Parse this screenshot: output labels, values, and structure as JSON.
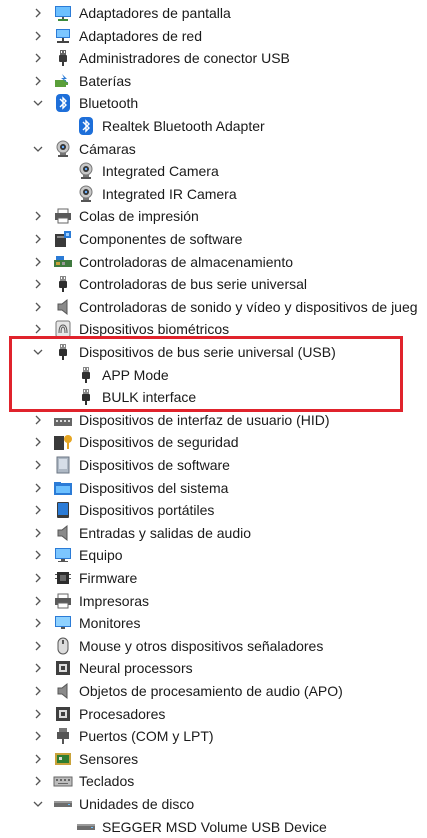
{
  "device_tree": [
    {
      "label": "Adaptadores de pantalla",
      "state": "collapsed",
      "level": 0,
      "icon": "display-adapter-icon"
    },
    {
      "label": "Adaptadores de red",
      "state": "collapsed",
      "level": 0,
      "icon": "network-adapter-icon"
    },
    {
      "label": "Administradores de conector USB",
      "state": "collapsed",
      "level": 0,
      "icon": "usb-connector-icon"
    },
    {
      "label": "Baterías",
      "state": "collapsed",
      "level": 0,
      "icon": "battery-icon"
    },
    {
      "label": "Bluetooth",
      "state": "expanded",
      "level": 0,
      "icon": "bluetooth-icon"
    },
    {
      "label": "Realtek Bluetooth Adapter",
      "state": "leaf",
      "level": 1,
      "icon": "bluetooth-icon"
    },
    {
      "label": "Cámaras",
      "state": "expanded",
      "level": 0,
      "icon": "camera-icon"
    },
    {
      "label": "Integrated Camera",
      "state": "leaf",
      "level": 1,
      "icon": "camera-icon"
    },
    {
      "label": "Integrated IR Camera",
      "state": "leaf",
      "level": 1,
      "icon": "camera-icon"
    },
    {
      "label": "Colas de impresión",
      "state": "collapsed",
      "level": 0,
      "icon": "printer-icon"
    },
    {
      "label": "Componentes de software",
      "state": "collapsed",
      "level": 0,
      "icon": "software-component-icon"
    },
    {
      "label": "Controladoras de almacenamiento",
      "state": "collapsed",
      "level": 0,
      "icon": "storage-controller-icon"
    },
    {
      "label": "Controladoras de bus serie universal",
      "state": "collapsed",
      "level": 0,
      "icon": "usb-plug-icon"
    },
    {
      "label": "Controladoras de sonido y vídeo y dispositivos de jueg",
      "state": "collapsed",
      "level": 0,
      "icon": "speaker-icon"
    },
    {
      "label": "Dispositivos biométricos",
      "state": "collapsed",
      "level": 0,
      "icon": "fingerprint-icon"
    },
    {
      "label": "Dispositivos de bus serie universal (USB)",
      "state": "expanded",
      "level": 0,
      "icon": "usb-plug-icon"
    },
    {
      "label": "APP Mode",
      "state": "leaf",
      "level": 1,
      "icon": "usb-plug-icon"
    },
    {
      "label": "BULK interface",
      "state": "leaf",
      "level": 1,
      "icon": "usb-plug-icon"
    },
    {
      "label": "Dispositivos de interfaz de usuario (HID)",
      "state": "collapsed",
      "level": 0,
      "icon": "hid-icon"
    },
    {
      "label": "Dispositivos de seguridad",
      "state": "collapsed",
      "level": 0,
      "icon": "security-key-icon"
    },
    {
      "label": "Dispositivos de software",
      "state": "collapsed",
      "level": 0,
      "icon": "software-device-icon"
    },
    {
      "label": "Dispositivos del sistema",
      "state": "collapsed",
      "level": 0,
      "icon": "system-folder-icon"
    },
    {
      "label": "Dispositivos portátiles",
      "state": "collapsed",
      "level": 0,
      "icon": "portable-device-icon"
    },
    {
      "label": "Entradas y salidas de audio",
      "state": "collapsed",
      "level": 0,
      "icon": "speaker-icon"
    },
    {
      "label": "Equipo",
      "state": "collapsed",
      "level": 0,
      "icon": "computer-icon"
    },
    {
      "label": "Firmware",
      "state": "collapsed",
      "level": 0,
      "icon": "firmware-icon"
    },
    {
      "label": "Impresoras",
      "state": "collapsed",
      "level": 0,
      "icon": "printer-icon"
    },
    {
      "label": "Monitores",
      "state": "collapsed",
      "level": 0,
      "icon": "monitor-icon"
    },
    {
      "label": "Mouse y otros dispositivos señaladores",
      "state": "collapsed",
      "level": 0,
      "icon": "mouse-icon"
    },
    {
      "label": "Neural processors",
      "state": "collapsed",
      "level": 0,
      "icon": "processor-icon"
    },
    {
      "label": "Objetos de procesamiento de audio (APO)",
      "state": "collapsed",
      "level": 0,
      "icon": "speaker-icon"
    },
    {
      "label": "Procesadores",
      "state": "collapsed",
      "level": 0,
      "icon": "processor-icon"
    },
    {
      "label": "Puertos (COM y LPT)",
      "state": "collapsed",
      "level": 0,
      "icon": "port-icon"
    },
    {
      "label": "Sensores",
      "state": "collapsed",
      "level": 0,
      "icon": "sensor-icon"
    },
    {
      "label": "Teclados",
      "state": "collapsed",
      "level": 0,
      "icon": "keyboard-icon"
    },
    {
      "label": "Unidades de disco",
      "state": "expanded",
      "level": 0,
      "icon": "disk-drive-icon"
    },
    {
      "label": "SEGGER MSD Volume USB Device",
      "state": "leaf",
      "level": 1,
      "icon": "disk-drive-icon"
    }
  ],
  "highlight_color": "#e0232c"
}
